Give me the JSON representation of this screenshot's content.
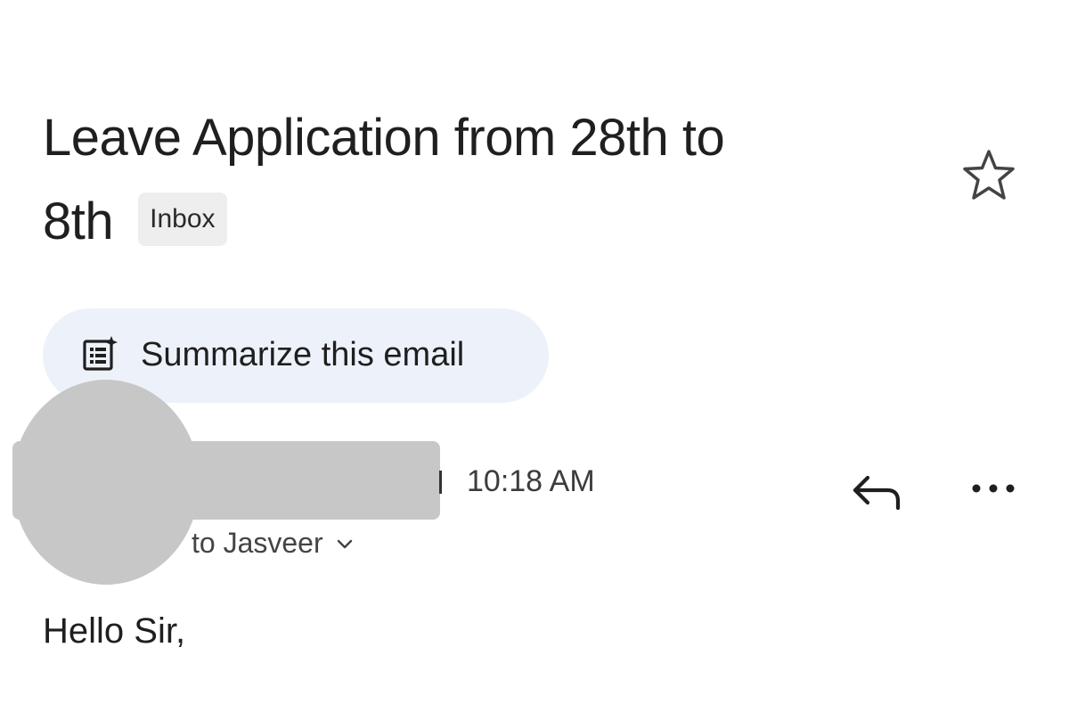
{
  "email": {
    "subject_line1": "Leave Application from 28th to",
    "subject_line2": "8th",
    "label_badge": "Inbox",
    "summarize_label": "Summarize this email",
    "time": "10:18 AM",
    "recipient_text": "to Jasveer",
    "body_greeting": "Hello Sir,"
  },
  "icons": {
    "star": "star-outline-icon",
    "summarize": "summarize-sparkle-icon",
    "reply": "reply-icon",
    "more": "more-horizontal-icon",
    "recipient_details": "chevron-down-icon"
  },
  "colors": {
    "summarize_chip_bg": "#edf2fa",
    "badge_bg": "#eeeeee",
    "redaction_gray": "#c7c7c7",
    "text_primary": "#1f1f1f"
  }
}
